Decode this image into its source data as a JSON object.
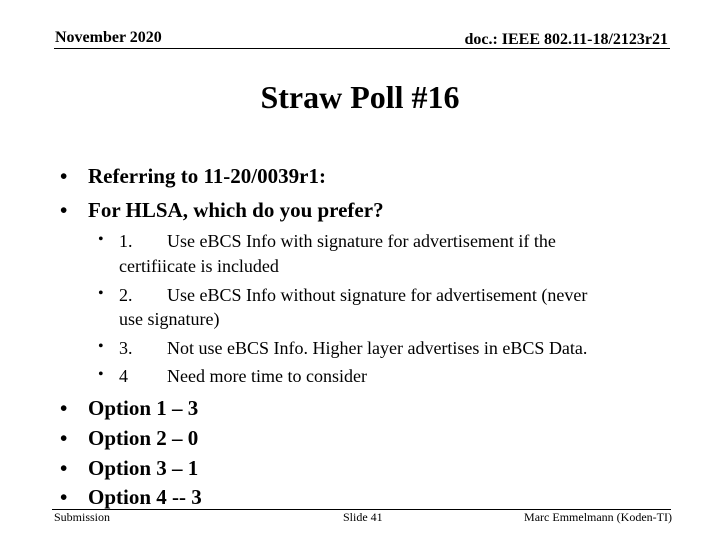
{
  "header": {
    "date": "November 2020",
    "doc_id": "doc.: IEEE 802.11-18/2123r21"
  },
  "title": "Straw Poll #16",
  "bullets": [
    "Referring to 11-20/0039r1:",
    "For HLSA, which do you prefer?"
  ],
  "options": [
    {
      "num": "1.",
      "line1": "Use eBCS Info with signature for advertisement if the",
      "line2": "certifiicate is included"
    },
    {
      "num": "2.",
      "line1": "Use eBCS Info without signature for advertisement (never",
      "line2": "use signature)"
    },
    {
      "num": "3.",
      "line1": "Not use eBCS Info. Higher layer advertises in eBCS Data."
    },
    {
      "num": "4",
      "line1": "Need more time to consider"
    }
  ],
  "results": [
    "Option 1 –  3",
    "Option 2 – 0",
    "Option 3 – 1",
    "Option 4 -- 3"
  ],
  "bullet_glyph": "•",
  "footer": {
    "left": "Submission",
    "center": "Slide 41",
    "right": "Marc Emmelmann (Koden-TI)"
  }
}
